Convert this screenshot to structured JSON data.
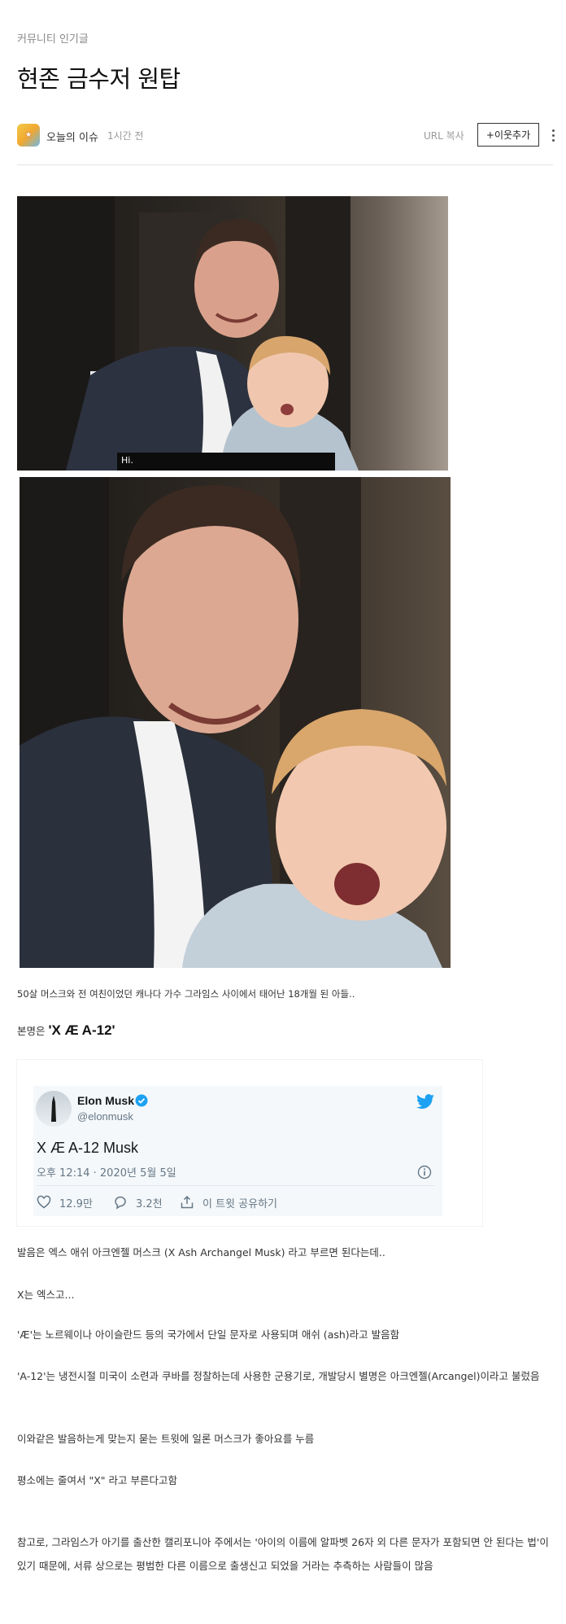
{
  "header": {
    "category": "커뮤니티 인기글",
    "title": "현존 금수저 원탑"
  },
  "meta": {
    "author": "오늘의 이슈",
    "time": "1시간 전",
    "url_copy": "URL 복사",
    "add_neighbor": "+이웃추가"
  },
  "images": {
    "photo1_caption": "Hi."
  },
  "body": {
    "intro": "50살 머스크와 전 여친이었던 캐나다 가수 그라임스 사이에서 태어난 18개월 된 아들..",
    "real_name_prefix": "본명은 ",
    "real_name": "'X Æ A-12'"
  },
  "tweet": {
    "name": "Elon Musk",
    "handle": "@elonmusk",
    "text": "X Æ A-12 Musk",
    "datetime": "오후 12:14 · 2020년 5월 5일",
    "likes": "12.9만",
    "replies": "3.2천",
    "share": "이 트윗 공유하기"
  },
  "paragraphs": {
    "p1": "발음은 엑스 애쉬 아크엔젤 머스크 (X Ash Archangel Musk) 라고 부르면 된다는데..",
    "p2": "X는 엑스고...",
    "p3": "'Æ'는 노르웨이나 아이슬란드 등의 국가에서 단일 문자로 사용되며 애쉬 (ash)라고 발음함",
    "p4": "'A-12'는 냉전시절 미국이 소련과 쿠바를 정찰하는데 사용한 군용기로, 개발당시 별명은 아크엔젤(Arcangel)이라고 불렀음",
    "p5": "이와같은 발음하는게 맞는지 묻는 트윗에 일론 머스크가 좋아요를 누름",
    "p6": "평소에는 줄여서 \"X\" 라고 부른다고함",
    "p7": "참고로, 그라임스가 아기를 출산한 캘리포니아 주에서는 '아이의 이름에 알파벳 26자 외 다른 문자가 포함되면 안 된다는 법'이 있기 때문에, 서류 상으로는 평범한 다른 이름으로 출생신고 되었을 거라는 추측하는 사람들이 많음"
  },
  "icons": {
    "more": "more-vertical-icon",
    "verified": "verified-badge-icon",
    "bird": "twitter-bird-icon",
    "info": "info-icon",
    "like": "heart-icon",
    "reply": "speech-bubble-icon",
    "share": "share-icon"
  },
  "colors": {
    "twitter_blue": "#1da1f2",
    "divider": "#e4e4e4",
    "muted_text": "#999999"
  }
}
